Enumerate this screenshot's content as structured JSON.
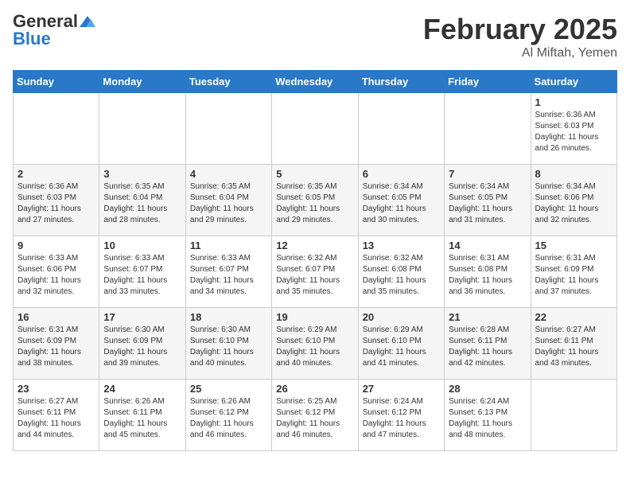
{
  "logo": {
    "general": "General",
    "blue": "Blue"
  },
  "title": "February 2025",
  "location": "Al Miftah, Yemen",
  "days_of_week": [
    "Sunday",
    "Monday",
    "Tuesday",
    "Wednesday",
    "Thursday",
    "Friday",
    "Saturday"
  ],
  "weeks": [
    [
      {
        "day": "",
        "info": ""
      },
      {
        "day": "",
        "info": ""
      },
      {
        "day": "",
        "info": ""
      },
      {
        "day": "",
        "info": ""
      },
      {
        "day": "",
        "info": ""
      },
      {
        "day": "",
        "info": ""
      },
      {
        "day": "1",
        "info": "Sunrise: 6:36 AM\nSunset: 6:03 PM\nDaylight: 11 hours and 26 minutes."
      }
    ],
    [
      {
        "day": "2",
        "info": "Sunrise: 6:36 AM\nSunset: 6:03 PM\nDaylight: 11 hours and 27 minutes."
      },
      {
        "day": "3",
        "info": "Sunrise: 6:35 AM\nSunset: 6:04 PM\nDaylight: 11 hours and 28 minutes."
      },
      {
        "day": "4",
        "info": "Sunrise: 6:35 AM\nSunset: 6:04 PM\nDaylight: 11 hours and 29 minutes."
      },
      {
        "day": "5",
        "info": "Sunrise: 6:35 AM\nSunset: 6:05 PM\nDaylight: 11 hours and 29 minutes."
      },
      {
        "day": "6",
        "info": "Sunrise: 6:34 AM\nSunset: 6:05 PM\nDaylight: 11 hours and 30 minutes."
      },
      {
        "day": "7",
        "info": "Sunrise: 6:34 AM\nSunset: 6:05 PM\nDaylight: 11 hours and 31 minutes."
      },
      {
        "day": "8",
        "info": "Sunrise: 6:34 AM\nSunset: 6:06 PM\nDaylight: 11 hours and 32 minutes."
      }
    ],
    [
      {
        "day": "9",
        "info": "Sunrise: 6:33 AM\nSunset: 6:06 PM\nDaylight: 11 hours and 32 minutes."
      },
      {
        "day": "10",
        "info": "Sunrise: 6:33 AM\nSunset: 6:07 PM\nDaylight: 11 hours and 33 minutes."
      },
      {
        "day": "11",
        "info": "Sunrise: 6:33 AM\nSunset: 6:07 PM\nDaylight: 11 hours and 34 minutes."
      },
      {
        "day": "12",
        "info": "Sunrise: 6:32 AM\nSunset: 6:07 PM\nDaylight: 11 hours and 35 minutes."
      },
      {
        "day": "13",
        "info": "Sunrise: 6:32 AM\nSunset: 6:08 PM\nDaylight: 11 hours and 35 minutes."
      },
      {
        "day": "14",
        "info": "Sunrise: 6:31 AM\nSunset: 6:08 PM\nDaylight: 11 hours and 36 minutes."
      },
      {
        "day": "15",
        "info": "Sunrise: 6:31 AM\nSunset: 6:09 PM\nDaylight: 11 hours and 37 minutes."
      }
    ],
    [
      {
        "day": "16",
        "info": "Sunrise: 6:31 AM\nSunset: 6:09 PM\nDaylight: 11 hours and 38 minutes."
      },
      {
        "day": "17",
        "info": "Sunrise: 6:30 AM\nSunset: 6:09 PM\nDaylight: 11 hours and 39 minutes."
      },
      {
        "day": "18",
        "info": "Sunrise: 6:30 AM\nSunset: 6:10 PM\nDaylight: 11 hours and 40 minutes."
      },
      {
        "day": "19",
        "info": "Sunrise: 6:29 AM\nSunset: 6:10 PM\nDaylight: 11 hours and 40 minutes."
      },
      {
        "day": "20",
        "info": "Sunrise: 6:29 AM\nSunset: 6:10 PM\nDaylight: 11 hours and 41 minutes."
      },
      {
        "day": "21",
        "info": "Sunrise: 6:28 AM\nSunset: 6:11 PM\nDaylight: 11 hours and 42 minutes."
      },
      {
        "day": "22",
        "info": "Sunrise: 6:27 AM\nSunset: 6:11 PM\nDaylight: 11 hours and 43 minutes."
      }
    ],
    [
      {
        "day": "23",
        "info": "Sunrise: 6:27 AM\nSunset: 6:11 PM\nDaylight: 11 hours and 44 minutes."
      },
      {
        "day": "24",
        "info": "Sunrise: 6:26 AM\nSunset: 6:11 PM\nDaylight: 11 hours and 45 minutes."
      },
      {
        "day": "25",
        "info": "Sunrise: 6:26 AM\nSunset: 6:12 PM\nDaylight: 11 hours and 46 minutes."
      },
      {
        "day": "26",
        "info": "Sunrise: 6:25 AM\nSunset: 6:12 PM\nDaylight: 11 hours and 46 minutes."
      },
      {
        "day": "27",
        "info": "Sunrise: 6:24 AM\nSunset: 6:12 PM\nDaylight: 11 hours and 47 minutes."
      },
      {
        "day": "28",
        "info": "Sunrise: 6:24 AM\nSunset: 6:13 PM\nDaylight: 11 hours and 48 minutes."
      },
      {
        "day": "",
        "info": ""
      }
    ]
  ]
}
